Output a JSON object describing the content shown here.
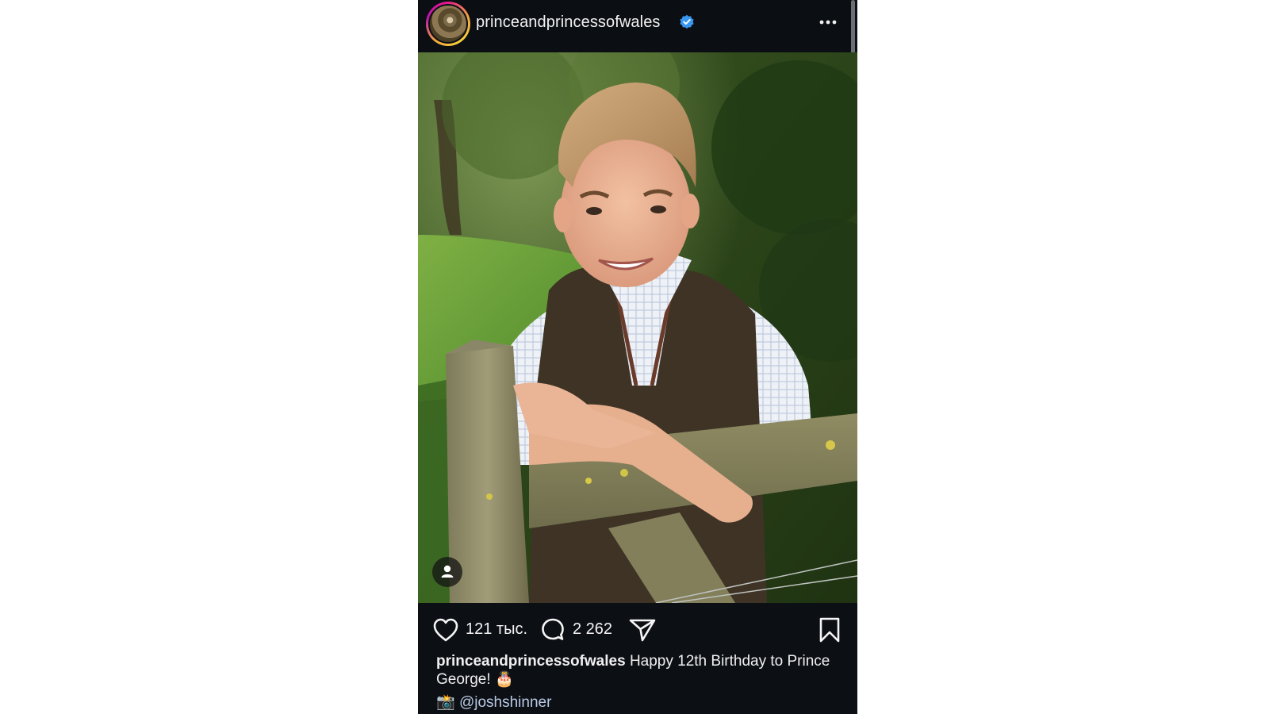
{
  "post": {
    "username": "princeandprincessofwales",
    "verified_icon": "verified-badge-icon",
    "more_icon": "more-options-icon",
    "image_alt": "Prince George leaning on a wooden gate",
    "tag_icon": "person-tag-icon",
    "likes_count": "121 тыс.",
    "comments_count": "2 262",
    "caption_user": "princeandprincessofwales",
    "caption_text": "Happy 12th Birthday to Prince George!",
    "caption_emoji": "🎂",
    "credit_emoji": "📸",
    "credit_mention": "@joshshinner"
  },
  "colors": {
    "background": "#0c0f14",
    "verified": "#3897f0",
    "mention": "#b9cbe6"
  }
}
